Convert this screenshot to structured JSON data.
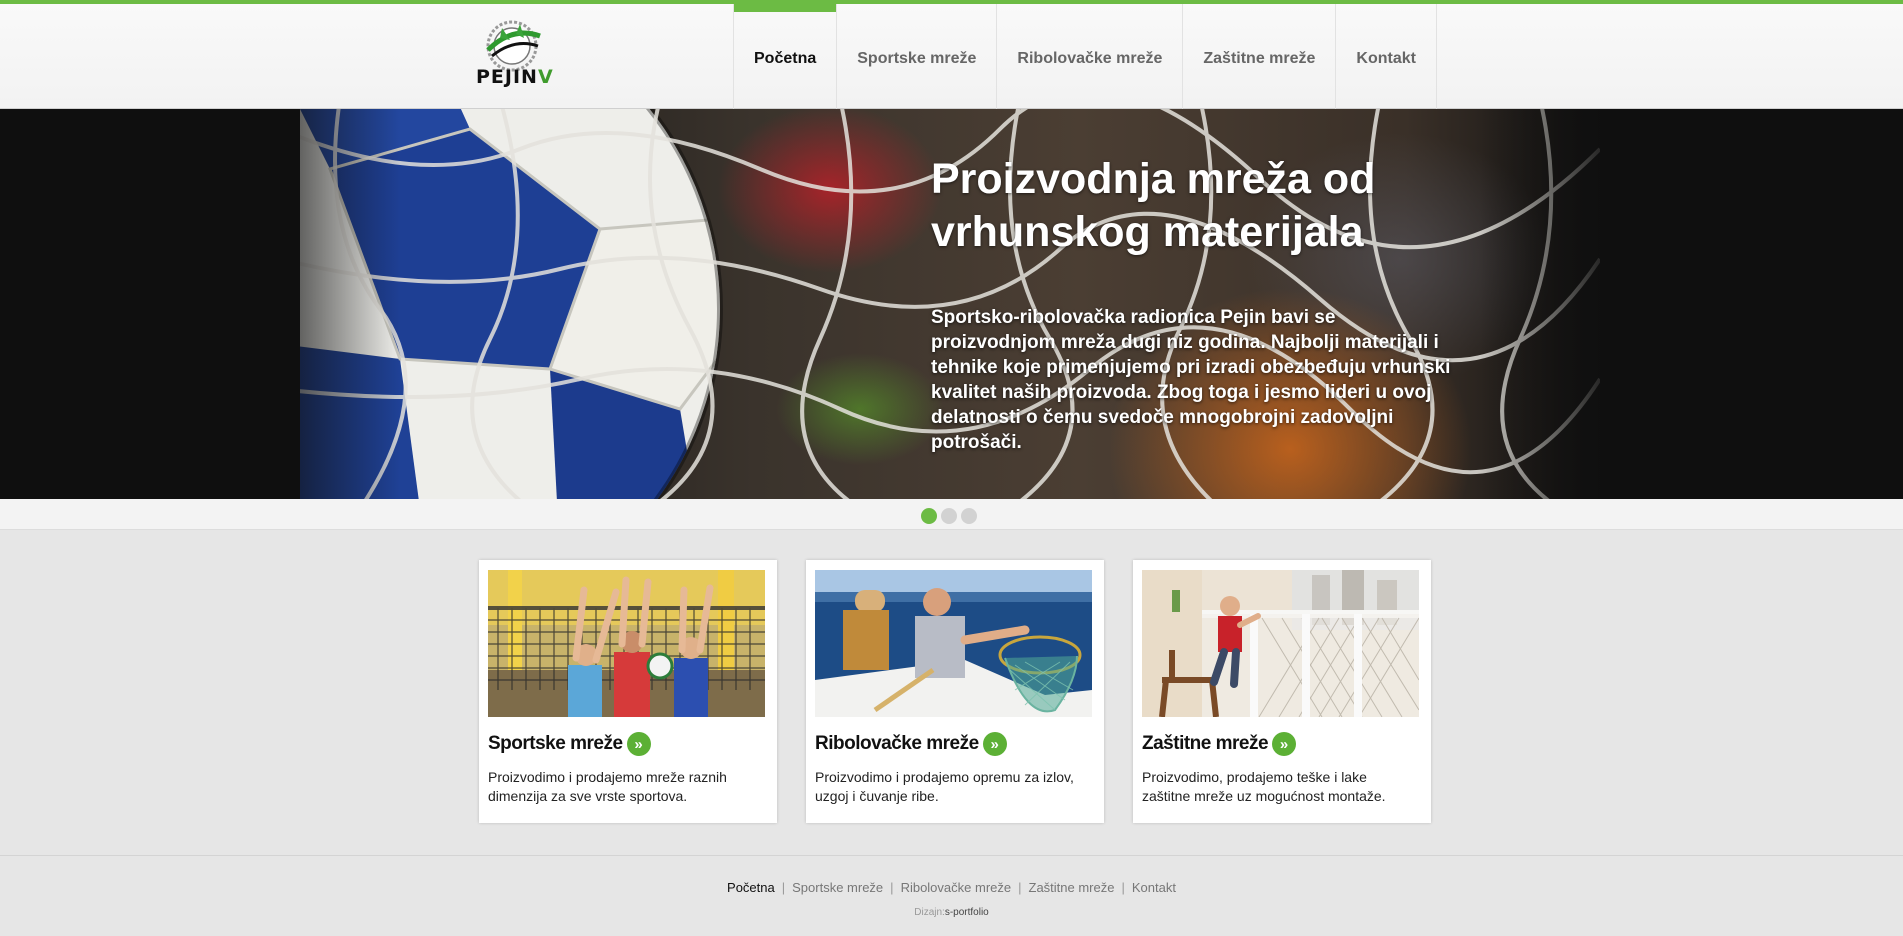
{
  "brand": {
    "logo_text_main": "PEJIN",
    "logo_text_accent": "V",
    "accent_color": "#6cbb44"
  },
  "nav": {
    "items": [
      {
        "label": "Početna",
        "active": true
      },
      {
        "label": "Sportske mreže",
        "active": false
      },
      {
        "label": "Ribolovačke mreže",
        "active": false
      },
      {
        "label": "Zaštitne mreže",
        "active": false
      },
      {
        "label": "Kontakt",
        "active": false
      }
    ]
  },
  "hero": {
    "title": "Proizvodnja mreža od vrhunskog materijala",
    "text": "Sportsko-ribolovačka radionica Pejin bavi se proizvodnjom mreža dugi niz godina. Najbolji materijali i tehnike koje primenjujemo pri izradi obezbeđuju vrhunski kvalitet naših proizvoda. Zbog toga i jesmo lideri u ovoj delatnosti o čemu svedoče mnogobrojni zadovoljni potrošači.",
    "slides_total": 3,
    "active_slide": 1
  },
  "cards": [
    {
      "title": "Sportske mreže",
      "text": "Proizvodimo i prodajemo mreže raznih dimenzija za sve vrste sportova.",
      "icon": "chevron-double-right-icon"
    },
    {
      "title": "Ribolovačke mreže",
      "text": "Proizvodimo i prodajemo opremu za izlov, uzgoj i čuvanje ribe.",
      "icon": "chevron-double-right-icon"
    },
    {
      "title": "Zaštitne mreže",
      "text": "Proizvodimo, prodajemo teške i lake zaštitne mreže uz mogućnost montaže.",
      "icon": "chevron-double-right-icon"
    }
  ],
  "footer": {
    "links": [
      "Početna",
      "Sportske mreže",
      "Ribolovačke mreže",
      "Zaštitne mreže",
      "Kontakt"
    ],
    "separator": "|",
    "credit_label": "Dizajn:",
    "credit_name": "s-portfolio"
  }
}
